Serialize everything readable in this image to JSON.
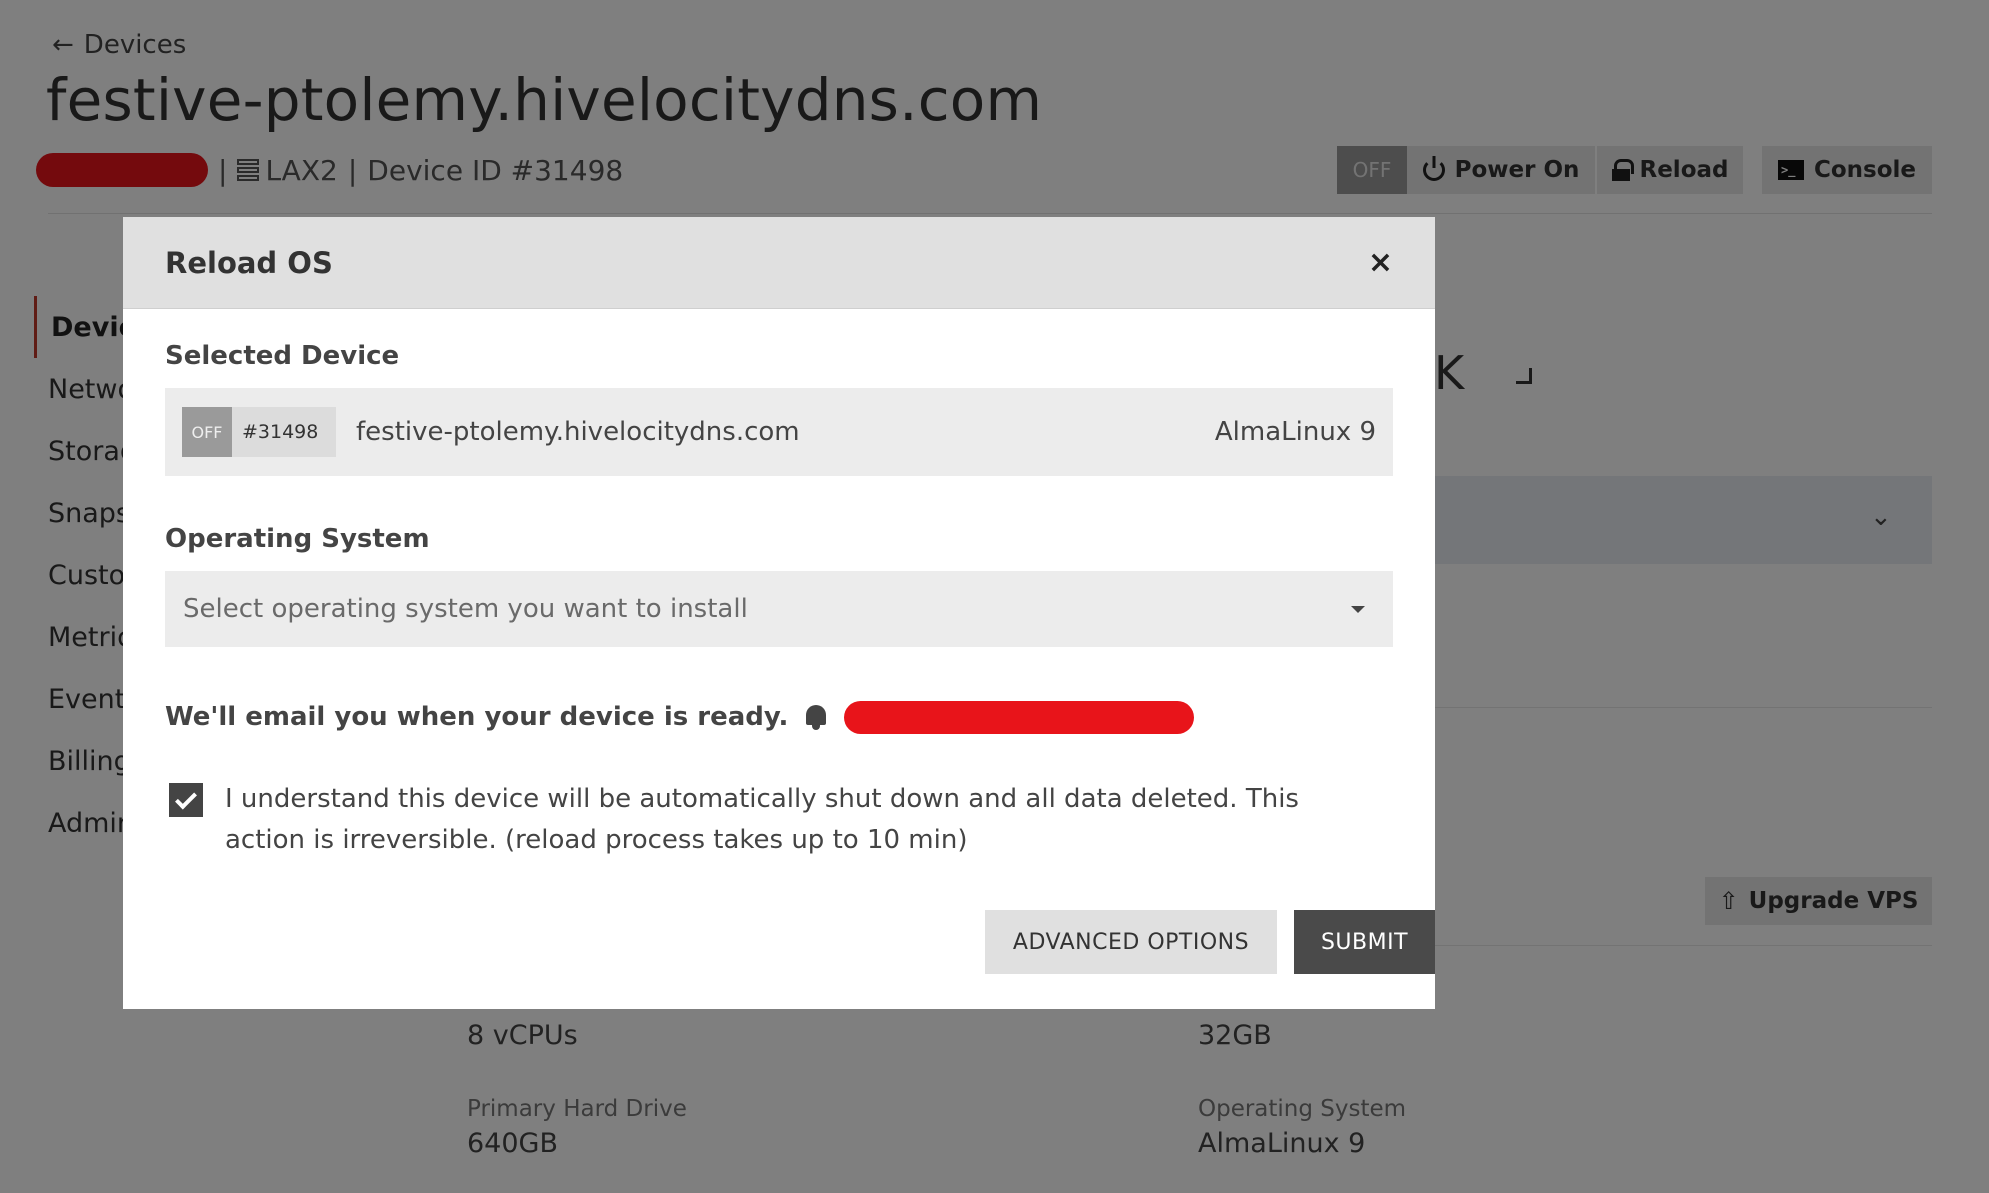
{
  "header": {
    "back_label": "Devices",
    "title": "festive-ptolemy.hivelocitydns.com",
    "location": "LAX2",
    "device_id": "Device ID #31498",
    "separator": "|"
  },
  "actions": {
    "status": "OFF",
    "power_on": "Power On",
    "reload": "Reload",
    "console": "Console",
    "console_glyph": ">_"
  },
  "sidebar": {
    "items": [
      {
        "label": "Devic"
      },
      {
        "label": "Netwo"
      },
      {
        "label": "Storag"
      },
      {
        "label": "Snaps"
      },
      {
        "label": "Custo"
      },
      {
        "label": "Metric"
      },
      {
        "label": "Event"
      },
      {
        "label": "Billing"
      },
      {
        "label": "Admin"
      }
    ]
  },
  "background": {
    "fragment_k": "K",
    "upgrade_label": "Upgrade VPS",
    "specs": [
      {
        "label": "",
        "value": "8 vCPUs"
      },
      {
        "label": "",
        "value": "32GB"
      },
      {
        "label": "Primary Hard Drive",
        "value": "640GB"
      },
      {
        "label": "Operating System",
        "value": "AlmaLinux 9"
      }
    ]
  },
  "modal": {
    "title": "Reload OS",
    "close_glyph": "×",
    "selected_device_label": "Selected Device",
    "device": {
      "status": "OFF",
      "id": "#31498",
      "hostname": "festive-ptolemy.hivelocitydns.com",
      "os": "AlmaLinux 9"
    },
    "os_label": "Operating System",
    "os_placeholder": "Select operating system you want to install",
    "email_notice": "We'll email you when your device is ready.",
    "acknowledge_text": "I understand this device will be automatically shut down and all data deleted. This action is irreversible. (reload process takes up to 10 min)",
    "acknowledge_checked": true,
    "advanced_label": "ADVANCED OPTIONS",
    "submit_label": "SUBMIT"
  },
  "colors": {
    "accent_red": "#e8141a",
    "submit_bg": "#4a4a4a",
    "overlay": "rgba(0,0,0,0.5)"
  }
}
